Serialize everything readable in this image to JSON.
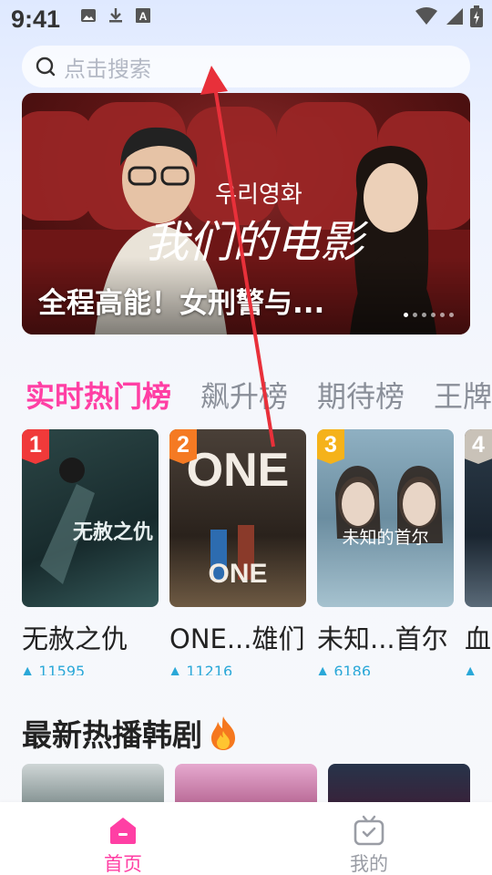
{
  "status_bar": {
    "time": "9:41",
    "left_icons": [
      "image-icon",
      "download-icon",
      "a-icon"
    ],
    "right_icons": [
      "wifi-icon",
      "signal-icon",
      "battery-icon"
    ]
  },
  "search": {
    "placeholder": "点击搜索"
  },
  "banner": {
    "title": "全程高能！女刑警与...",
    "art_caption_korean": "우리영화",
    "art_caption_chinese": "我们的电影",
    "slide_count": 6,
    "active_slide": 1
  },
  "rank_tabs": [
    {
      "label": "实时热门榜",
      "active": true
    },
    {
      "label": "飙升榜",
      "active": false
    },
    {
      "label": "期待榜",
      "active": false
    },
    {
      "label": "王牌",
      "active": false
    }
  ],
  "rank_cards": [
    {
      "rank": "1",
      "badge_color": "#f03a3a",
      "title": "无赦之仇",
      "heat": "11595",
      "poster_text": "无赦之仇",
      "poster_colors": [
        "#1f3a3a",
        "#355a5a"
      ]
    },
    {
      "rank": "2",
      "badge_color": "#f57a23",
      "title": "ONE...雄们",
      "heat": "11216",
      "poster_text": "ONE",
      "poster_colors": [
        "#3a2e24",
        "#6e5a43"
      ]
    },
    {
      "rank": "3",
      "badge_color": "#f5b21a",
      "title": "未知...首尔",
      "heat": "6186",
      "poster_text": "未知的首尔",
      "poster_colors": [
        "#6b8da0",
        "#a6c2cf"
      ]
    },
    {
      "rank": "4",
      "badge_color": "#c9c2b8",
      "title": "血",
      "heat": "",
      "poster_text": "",
      "poster_colors": [
        "#2b3a48",
        "#5a6a78"
      ]
    }
  ],
  "section": {
    "title": "最新热播韩剧"
  },
  "bottom_nav": [
    {
      "label": "首页",
      "icon": "home-icon",
      "active": true
    },
    {
      "label": "我的",
      "icon": "tv-icon",
      "active": false
    }
  ],
  "colors": {
    "accent": "#ff3fa4",
    "heat": "#2aa8d8",
    "gesture_arrow": "#e8303a"
  }
}
